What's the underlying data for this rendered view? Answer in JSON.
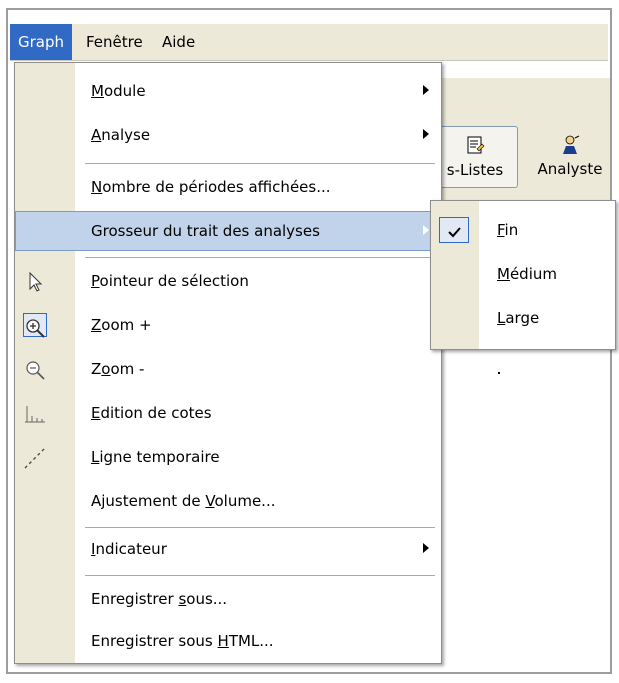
{
  "menubar": {
    "items": [
      "Graph",
      "Fenêtre",
      "Aide"
    ]
  },
  "toolbar": {
    "buttons": [
      {
        "label": "s-Listes",
        "icon": "list-sheet-icon"
      },
      {
        "label": "Analyste",
        "icon": "analyst-icon"
      }
    ]
  },
  "graph_menu": {
    "items": [
      {
        "pre": "",
        "u": "M",
        "post": "odule",
        "submenu": true
      },
      {
        "pre": "",
        "u": "A",
        "post": "nalyse",
        "submenu": true
      },
      {
        "pre": "",
        "u": "N",
        "post": "ombre de périodes affichées...",
        "submenu": false
      },
      {
        "pre": "Grosseur du trait des analyses",
        "u": "",
        "post": "",
        "submenu": true,
        "highlighted": true
      },
      {
        "pre": "",
        "u": "P",
        "post": "ointeur de sélection",
        "icon": "pointer-arrow-icon"
      },
      {
        "pre": "",
        "u": "Z",
        "post": "oom +",
        "icon": "zoom-in-icon",
        "checked": true
      },
      {
        "pre": "Z",
        "u": "o",
        "post": "om -",
        "icon": "zoom-out-icon"
      },
      {
        "pre": "",
        "u": "E",
        "post": "dition de cotes",
        "icon": "dimension-icon"
      },
      {
        "pre": "",
        "u": "L",
        "post": "igne temporaire",
        "icon": "dashed-line-icon"
      },
      {
        "pre": "Ajustement de ",
        "u": "V",
        "post": "olume..."
      },
      {
        "pre": "",
        "u": "I",
        "post": "ndicateur",
        "submenu": true
      },
      {
        "pre": "Enregistrer ",
        "u": "s",
        "post": "ous..."
      },
      {
        "pre": "Enregistrer sous ",
        "u": "H",
        "post": "TML..."
      }
    ]
  },
  "thickness_submenu": {
    "items": [
      {
        "pre": "",
        "u": "F",
        "post": "in",
        "checked": true
      },
      {
        "pre": "",
        "u": "M",
        "post": "édium",
        "checked": false
      },
      {
        "pre": "",
        "u": "L",
        "post": "arge",
        "checked": false
      }
    ]
  }
}
